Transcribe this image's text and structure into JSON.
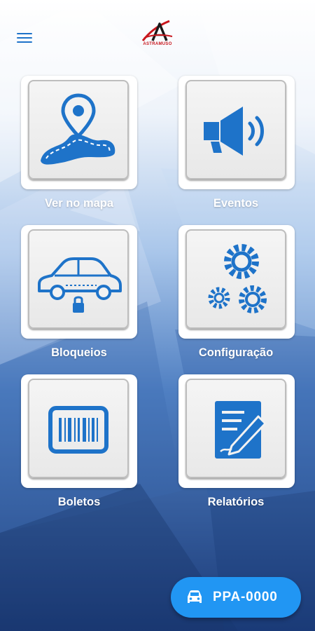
{
  "header": {
    "menu_icon": "hamburger-menu-icon",
    "logo_text": "ASTRAMUSO"
  },
  "tiles": [
    {
      "label": "Ver no mapa",
      "icon": "map-route-pin-icon"
    },
    {
      "label": "Eventos",
      "icon": "megaphone-icon"
    },
    {
      "label": "Bloqueios",
      "icon": "car-lock-icon"
    },
    {
      "label": "Configuração",
      "icon": "gears-icon"
    },
    {
      "label": "Boletos",
      "icon": "barcode-icon"
    },
    {
      "label": "Relatórios",
      "icon": "report-pen-icon"
    }
  ],
  "vehicle_button": {
    "icon": "car-icon",
    "plate": "PPA-0000"
  },
  "colors": {
    "accent": "#1e73c9",
    "fab": "#2196f3",
    "background_dark": "#1d3f7d",
    "logo_red": "#c8161d"
  }
}
